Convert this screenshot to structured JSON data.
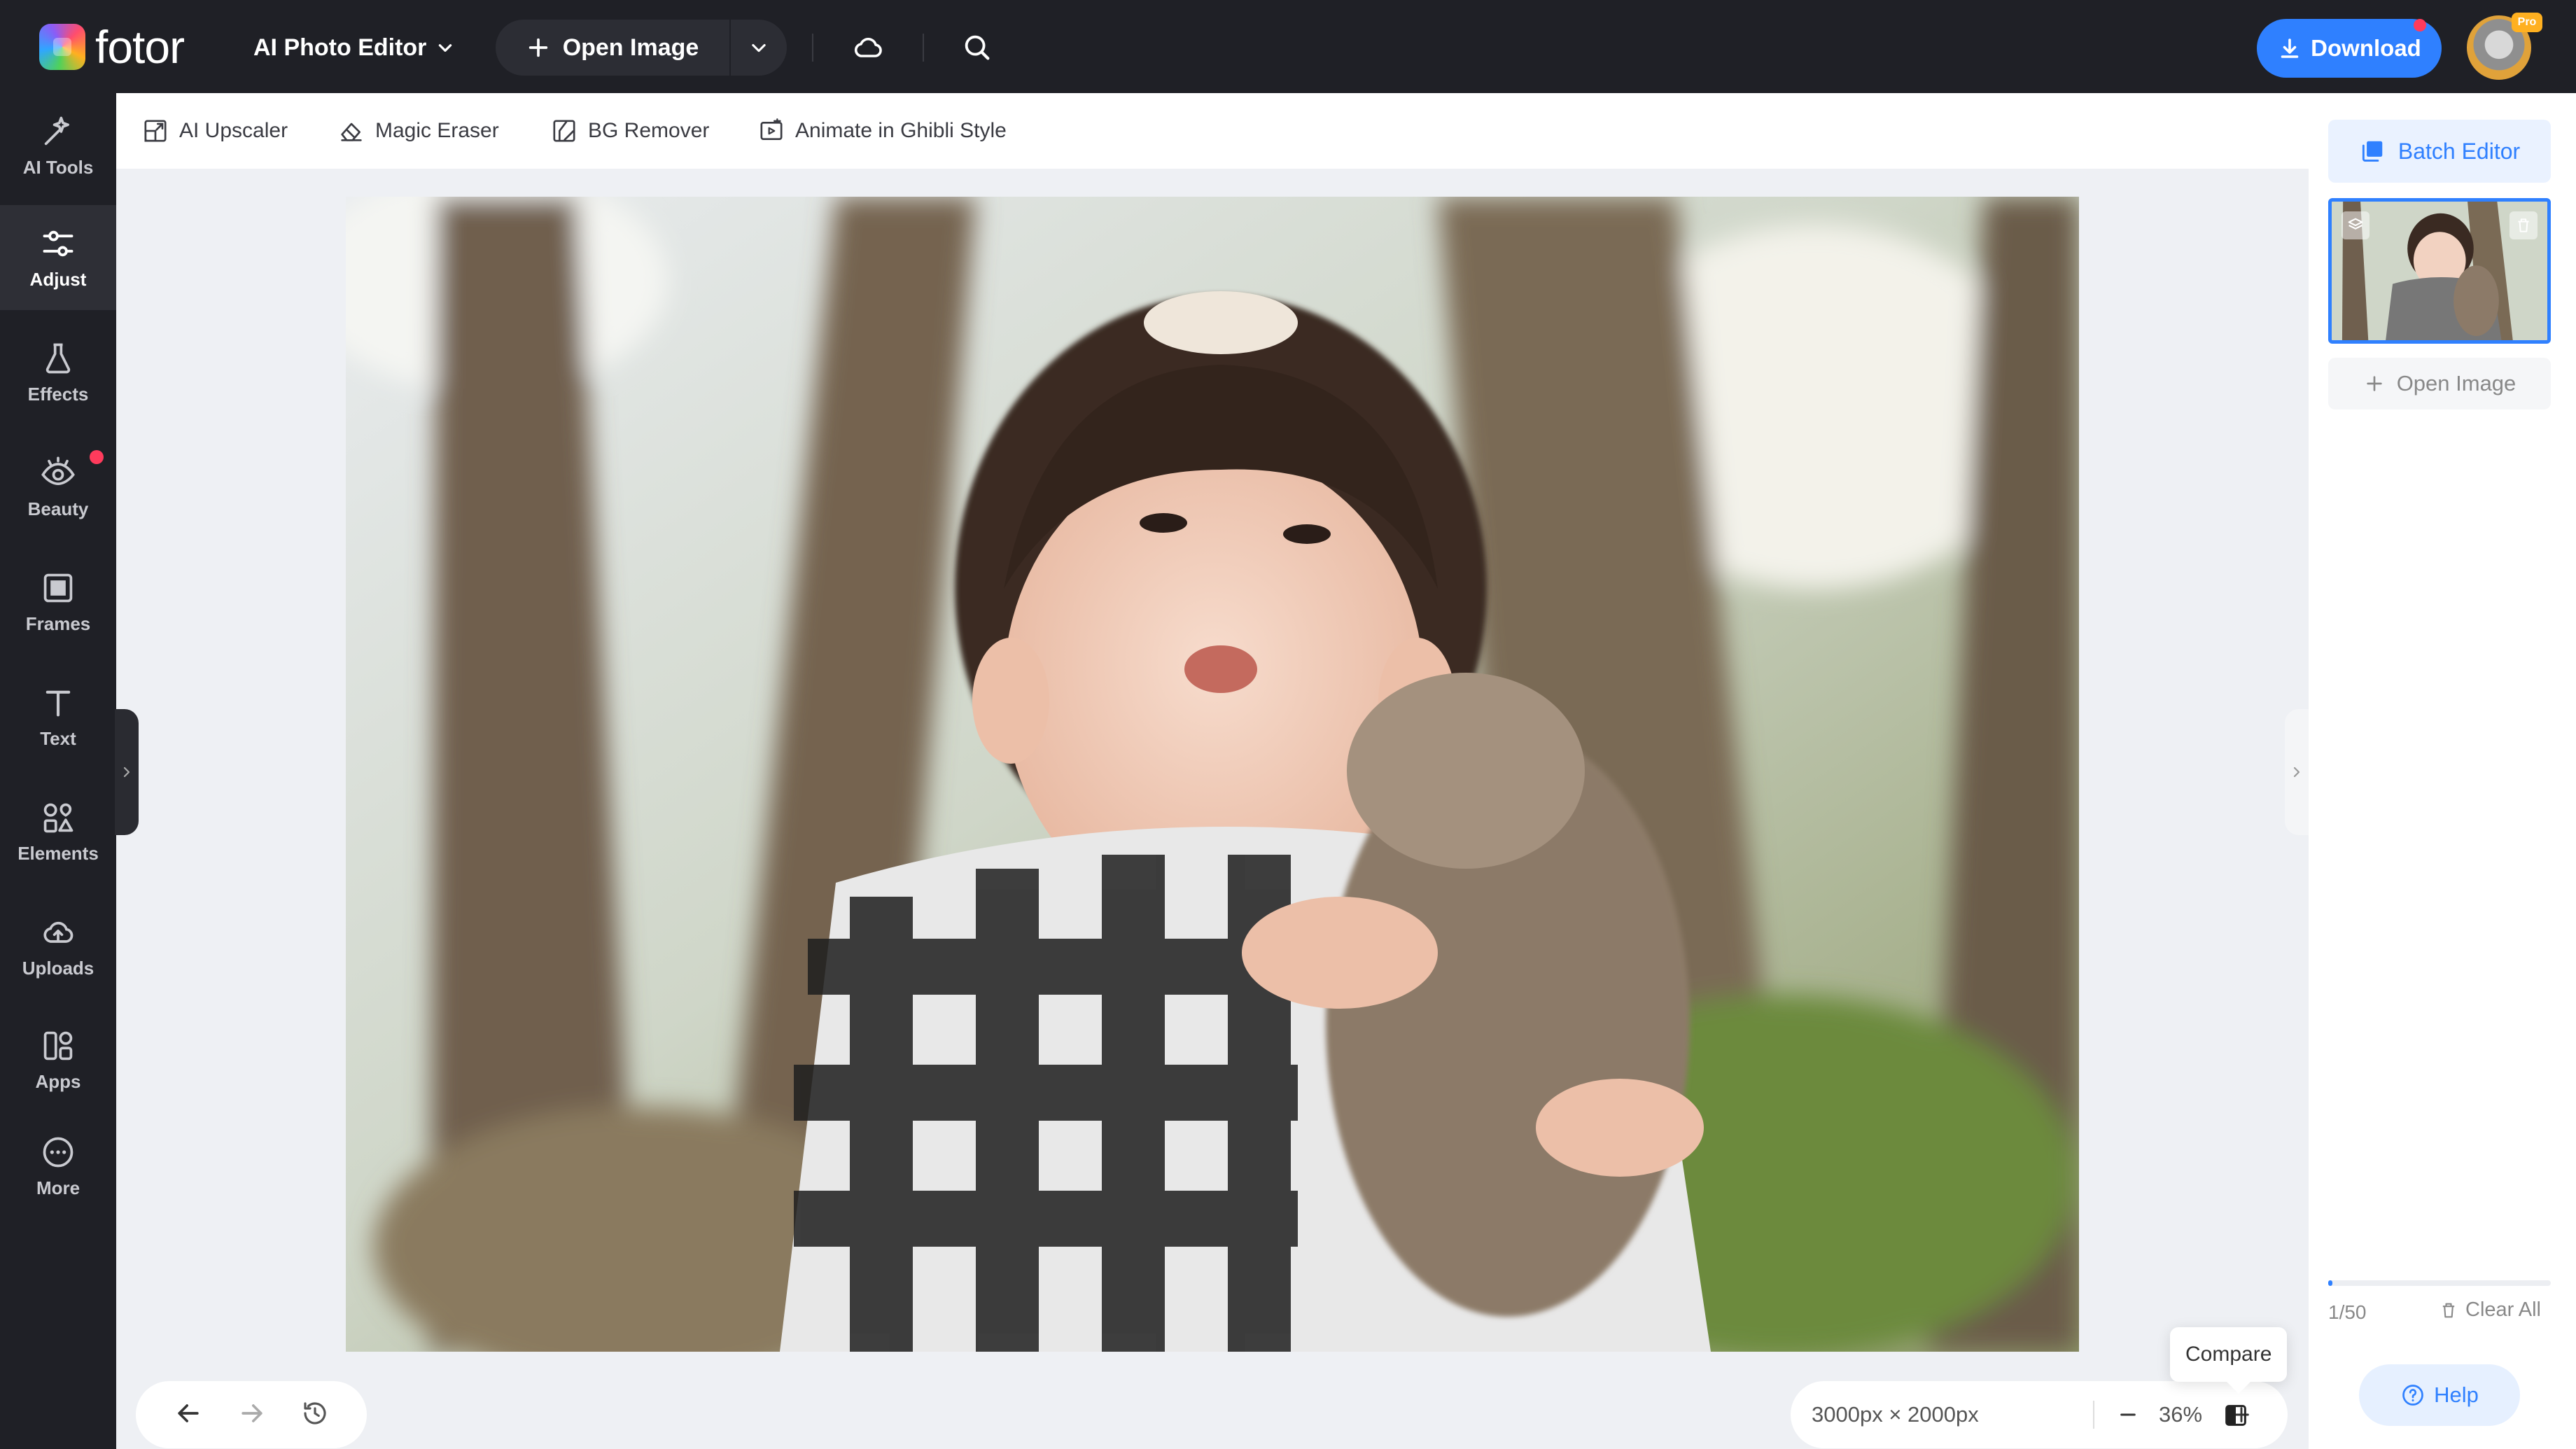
{
  "app": {
    "logo_text": "fotor",
    "mode": "AI Photo Editor",
    "open_image": "Open Image",
    "download": "Download",
    "pro_badge": "Pro"
  },
  "sidebar": {
    "items": [
      {
        "label": "AI Tools",
        "icon": "sparkle-wand-icon"
      },
      {
        "label": "Adjust",
        "icon": "sliders-icon",
        "active": true
      },
      {
        "label": "Effects",
        "icon": "flask-icon"
      },
      {
        "label": "Beauty",
        "icon": "eye-icon",
        "badge_dot": true
      },
      {
        "label": "Frames",
        "icon": "frame-icon"
      },
      {
        "label": "Text",
        "icon": "text-icon"
      },
      {
        "label": "Elements",
        "icon": "shapes-icon"
      },
      {
        "label": "Uploads",
        "icon": "cloud-upload-icon"
      },
      {
        "label": "Apps",
        "icon": "apps-icon"
      },
      {
        "label": "More",
        "icon": "more-dots-icon"
      }
    ]
  },
  "toolbar": {
    "tools": [
      {
        "label": "AI Upscaler",
        "icon": "upscale-icon"
      },
      {
        "label": "Magic Eraser",
        "icon": "eraser-icon"
      },
      {
        "label": "BG Remover",
        "icon": "bg-remove-icon"
      },
      {
        "label": "Animate in Ghibli Style",
        "icon": "animate-icon"
      }
    ]
  },
  "canvas": {
    "dimensions": "3000px × 2000px",
    "zoom": "36%",
    "compare_tooltip": "Compare"
  },
  "right_panel": {
    "batch_editor": "Batch Editor",
    "open_image": "Open Image",
    "count": "1/50",
    "progress_fraction": 0.02,
    "clear_all": "Clear All",
    "help": "Help"
  },
  "colors": {
    "accent": "#2f80ff",
    "dark_bg": "#1f2026",
    "notification": "#ff3b5c"
  }
}
